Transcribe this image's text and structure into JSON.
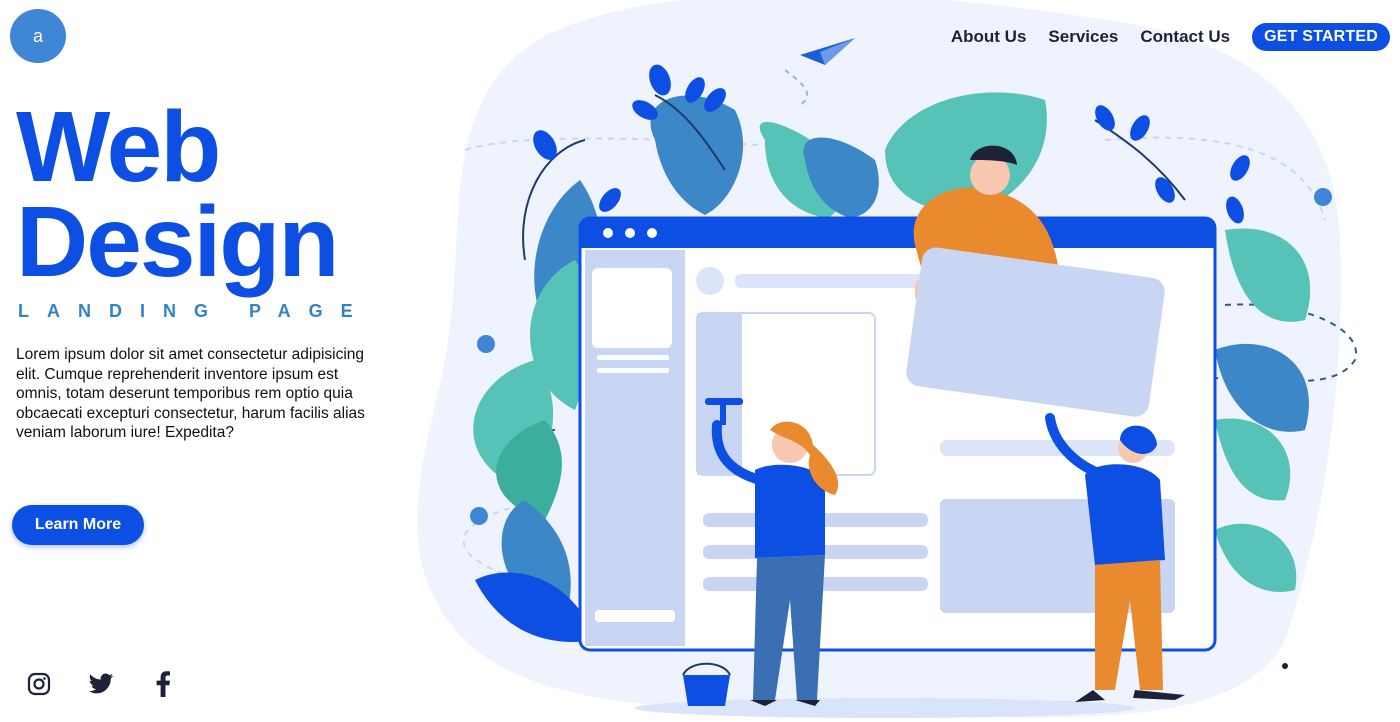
{
  "logo": {
    "letter": "a"
  },
  "nav": {
    "items": [
      {
        "label": "About Us"
      },
      {
        "label": "Services"
      },
      {
        "label": "Contact Us"
      }
    ],
    "cta": "GET STARTED"
  },
  "hero": {
    "title_line1": "Web",
    "title_line2": "Design",
    "subtitle": "LANDING PAGE",
    "description": "Lorem ipsum dolor sit amet consectetur adipisicing elit. Cumque reprehenderit inventore ipsum est omnis, totam deserunt temporibus rem optio quia obcaecati excepturi consectetur, harum facilis alias veniam laborum iure! Expedita?",
    "button": "Learn More"
  },
  "social": {
    "icons": [
      "instagram-icon",
      "twitter-icon",
      "facebook-icon"
    ]
  },
  "colors": {
    "brand": "#0d4fe2",
    "accent_light": "#3f86d6",
    "teal": "#56c2b8",
    "orange": "#ea8a2e",
    "text": "#1d2238"
  },
  "illustration": {
    "name": "web-design-team-illustration"
  }
}
